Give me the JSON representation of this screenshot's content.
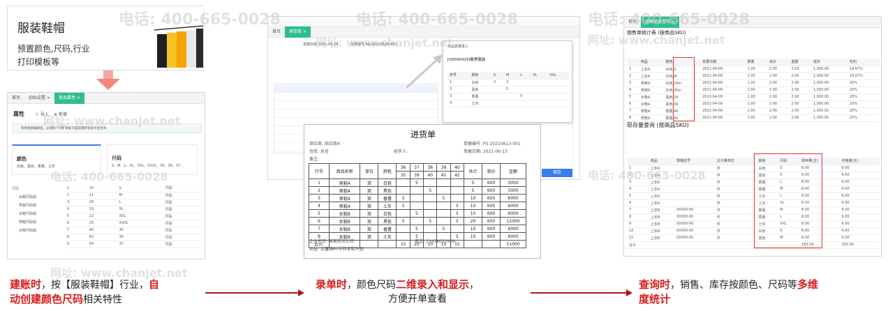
{
  "watermark": {
    "phone": "电话: 400-665-0028",
    "site": "网址: www.chanjet.net"
  },
  "card": {
    "title": "服装鞋帽",
    "line1": "预置颜色,尺码,行业",
    "line2": "打印模板等"
  },
  "left_app": {
    "tabs": [
      "首页",
      "初始设置 ×",
      "商品属性 ×"
    ],
    "section": "属性",
    "btn_import": "导入",
    "btn_add": "新增",
    "notice": "新增规格编辑后，必须按\"F5键\"刷新页面或重新登录才会生效",
    "color_title": "颜色",
    "color_values": "白色、黑色、香蕾、土灰",
    "size_title": "尺码",
    "size_values": "S、M、L、XL、XXL、XXXL、35、36、37...",
    "tree": [
      "尺码",
      "女服尺码组",
      "男装尺码组",
      "女鞋尺码组",
      "男鞋尺码组",
      "女鞋尺码组"
    ],
    "rows": [
      [
        "1",
        "10",
        "S",
        "尺码"
      ],
      [
        "2",
        "11",
        "M",
        "尺码"
      ],
      [
        "3",
        "16",
        "L",
        "尺码"
      ],
      [
        "4",
        "19",
        "XL",
        "尺码"
      ],
      [
        "5",
        "22",
        "XXL",
        "尺码"
      ],
      [
        "6",
        "25",
        "XXXL",
        "尺码"
      ],
      [
        "7",
        "40",
        "35",
        "尺码"
      ],
      [
        "8",
        "42",
        "36",
        "尺码"
      ],
      [
        "9",
        "44",
        "37",
        "尺码"
      ]
    ]
  },
  "mid_app": {
    "tabs": [
      "首页",
      "销货单 ×"
    ],
    "date_label": "单据日期",
    "date": "2021-05-26",
    "no_label": "单据编号",
    "no": "SA-20210526-001",
    "popup_title": "商品数量录入",
    "popup_item": "[00000009]春季服装",
    "popup_cols": [
      "序号",
      "颜色",
      "S",
      "M",
      "L",
      "XL",
      "XXL"
    ],
    "popup_rows": [
      [
        "1",
        "白色",
        "3",
        "3",
        "",
        "",
        ""
      ],
      [
        "2",
        "黑色",
        "",
        "5",
        "",
        "",
        ""
      ],
      [
        "3",
        "香蕾",
        "",
        "",
        "5",
        "",
        ""
      ],
      [
        "4",
        "土灰",
        "",
        "",
        "",
        "",
        ""
      ]
    ],
    "confirm": "保存"
  },
  "invoice": {
    "title": "进货单",
    "supplier": "供应商: 供应商A",
    "bill_no": "单据编号: PS-20210613-001",
    "warehouse": "仓库: 总仓",
    "handler": "经手人:",
    "date": "单据日期: 2021-06-13",
    "note": "备注:",
    "head": [
      "行号",
      "商品名称",
      "单位",
      "颜色",
      "36",
      "37",
      "38",
      "39",
      "40",
      "共计",
      "单价",
      "金额"
    ],
    "head2": [
      "35",
      "39",
      "40",
      "41",
      "42",
      "43",
      "44"
    ],
    "rows": [
      [
        "1",
        "男鞋A",
        "双",
        "白色",
        "",
        "5",
        "",
        "",
        "",
        "5",
        "600",
        "3000"
      ],
      [
        "2",
        "男鞋A",
        "双",
        "黑色",
        "",
        "",
        "5",
        "",
        "",
        "5",
        "600",
        "3000"
      ],
      [
        "3",
        "男鞋A",
        "双",
        "香蕾",
        "5",
        "",
        "",
        "5",
        "",
        "10",
        "600",
        "6000"
      ],
      [
        "4",
        "男鞋A",
        "双",
        "土灰",
        "5",
        "",
        "",
        "",
        "5",
        "10",
        "600",
        "6000"
      ],
      [
        "5",
        "女鞋B",
        "双",
        "白色",
        "",
        "5",
        "",
        "",
        "5",
        "10",
        "600",
        "6000"
      ],
      [
        "6",
        "女鞋B",
        "双",
        "黑色",
        "5",
        "",
        "5",
        "",
        "5",
        "20",
        "600",
        "12000"
      ],
      [
        "7",
        "女鞋B",
        "双",
        "香蕾",
        "",
        "5",
        "",
        "5",
        "",
        "10",
        "600",
        "6000"
      ],
      [
        "8",
        "女鞋B",
        "双",
        "土灰",
        "",
        "5",
        "",
        "",
        "5",
        "10",
        "600",
        "6000"
      ]
    ],
    "total": [
      "合计:",
      "",
      "",
      "",
      "15",
      "20",
      "10",
      "10",
      "15",
      "",
      "",
      "51000"
    ],
    "company": "企业名称:  某某商贸公司",
    "phone": "电话:  13438023499",
    "address": "地址:  北藩路60号和安软件园"
  },
  "right_app": {
    "tabs": [
      "首页",
      "销售单据查询 ×"
    ],
    "sales_title": "销售单统计表 (按商品SKU)",
    "stock_title": "现存量查询 (按商品SKU)",
    "sales_cols": [
      "",
      "商品",
      "颜色",
      "单据日期",
      "数量",
      "单价",
      "金额",
      "成本",
      "毛利"
    ],
    "sales_rows": [
      [
        "1",
        "上衣A",
        "白色/S",
        "2021-04-09",
        "1.00",
        "2.00",
        "2.00",
        "1,000.00",
        "16.67%"
      ],
      [
        "2",
        "上衣A",
        "白色/M",
        "2021-04-09",
        "1.00",
        "2.00",
        "2.00",
        "1,000.00",
        "16.67%"
      ],
      [
        "3",
        "男裤A",
        "白色/28in",
        "2021-04-09",
        "1.00",
        "2.00",
        "2.00",
        "1,000.00",
        "20%"
      ],
      [
        "4",
        "男裤A",
        "白色/30in",
        "2021-04-09",
        "1.00",
        "2.00",
        "2.00",
        "1,000.00",
        "20%"
      ],
      [
        "5",
        "女鞋A",
        "黑色/35",
        "2021-04-09",
        "1.00",
        "2.00",
        "2.00",
        "1,000.00",
        "20%"
      ],
      [
        "6",
        "女鞋A",
        "黑色/36",
        "2021-04-09",
        "1.00",
        "2.00",
        "2.00",
        "1,000.00",
        "20%"
      ],
      [
        "7",
        "男鞋A",
        "香蕾/40",
        "2021-04-09",
        "1.00",
        "2.00",
        "2.00",
        "1,000.00",
        "20%"
      ],
      [
        "8",
        "男鞋A",
        "香蕾/42",
        "2021-04-09",
        "1.00",
        "2.00",
        "2.00",
        "1,000.00",
        "20%"
      ]
    ],
    "stock_cols": [
      "",
      "商品",
      "规格型号",
      "主计量单位",
      "颜色",
      "尺码",
      "现存量(主)",
      "可用量(主)"
    ],
    "stock_rows": [
      [
        "1",
        "上衣A",
        "",
        "件",
        "白色",
        "S",
        "8.00",
        "6.00"
      ],
      [
        "2",
        "上衣A",
        "",
        "件",
        "黑色",
        "S",
        "8.00",
        "6.00"
      ],
      [
        "3",
        "上衣A",
        "",
        "件",
        "香蕾",
        "L",
        "8.00",
        "6.00"
      ],
      [
        "4",
        "上衣A",
        "",
        "件",
        "香蕾",
        "M",
        "8.00",
        "6.00"
      ],
      [
        "5",
        "上衣A",
        "",
        "件",
        "土灰",
        "L",
        "8.00",
        "6.00"
      ],
      [
        "6",
        "上衣A",
        "",
        "件",
        "土灰",
        "XL",
        "8.00",
        "6.00"
      ],
      [
        "7",
        "上衣B",
        "00000-00",
        "件",
        "香蕾",
        "M",
        "8.00",
        "6.00"
      ],
      [
        "8",
        "上衣B",
        "00000-00",
        "件",
        "香蕾",
        "L",
        "8.00",
        "6.00"
      ],
      [
        "9",
        "上衣B",
        "00000-00",
        "件",
        "土灰",
        "XXL",
        "8.00",
        "6.00"
      ],
      [
        "10",
        "上衣B",
        "00000-00",
        "件",
        "白色",
        "S",
        "8.00",
        "6.00"
      ],
      [
        "11",
        "上衣B",
        "00000-00",
        "件",
        "黑色",
        "M",
        "8.00",
        "6.00"
      ]
    ],
    "stock_total": [
      "合计",
      "",
      "",
      "",
      "",
      "",
      "183.00",
      "183.00"
    ]
  },
  "captions": {
    "c1_a": "建账时",
    "c1_b": "，按【服装鞋帽】行业，",
    "c1_c": "自",
    "c1_d": "动创建颜色尺码",
    "c1_e": "相关特性",
    "c2_a": "录单时",
    "c2_b": "，颜色尺码",
    "c2_c": "二维录入和显示",
    "c2_d": "，",
    "c2_e": "方便开单查看",
    "c3_a": "查询时",
    "c3_b": "，销售、库存按颜色、尺码等",
    "c3_c": "多维",
    "c3_d": "度统计"
  },
  "colors": {
    "accent": "#2dbe8d",
    "red": "#d71d1d",
    "arrow": "#b3131b",
    "blue": "#3b7de8"
  }
}
